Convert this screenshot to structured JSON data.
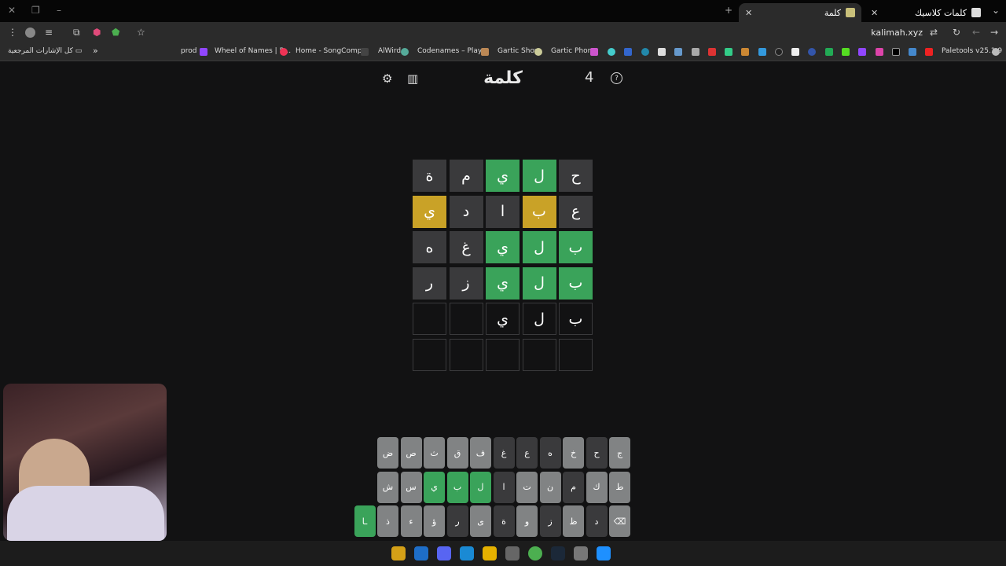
{
  "browser": {
    "tabs": [
      {
        "title": "كلمات كلاسيك"
      },
      {
        "title": "كلمة"
      }
    ],
    "url": "kalimah.xyz",
    "bookmarks_folder": "كل الإشارات المرجعية",
    "bookmarks": [
      "Paletools v25.1.9",
      "Gartic Phone",
      "Gartic Show",
      "Codenames – Play...",
      "AlWird",
      "Home - SongComp...",
      "Wheel of Names | R...",
      "prod"
    ],
    "bookmarks_more": "»"
  },
  "app": {
    "title": "كلمة",
    "count": "4",
    "icons": {
      "stats": "stats-icon",
      "settings": "gear-icon",
      "help": "help-icon"
    }
  },
  "board": {
    "rows": [
      [
        {
          "l": "ح",
          "s": "absent"
        },
        {
          "l": "ل",
          "s": "correct"
        },
        {
          "l": "ي",
          "s": "correct"
        },
        {
          "l": "م",
          "s": "absent"
        },
        {
          "l": "ة",
          "s": "absent"
        }
      ],
      [
        {
          "l": "ع",
          "s": "absent"
        },
        {
          "l": "ب",
          "s": "present"
        },
        {
          "l": "ا",
          "s": "absent"
        },
        {
          "l": "د",
          "s": "absent"
        },
        {
          "l": "ي",
          "s": "present"
        }
      ],
      [
        {
          "l": "ب",
          "s": "correct"
        },
        {
          "l": "ل",
          "s": "correct"
        },
        {
          "l": "ي",
          "s": "correct"
        },
        {
          "l": "غ",
          "s": "absent"
        },
        {
          "l": "ه",
          "s": "absent"
        }
      ],
      [
        {
          "l": "ب",
          "s": "correct"
        },
        {
          "l": "ل",
          "s": "correct"
        },
        {
          "l": "ي",
          "s": "correct"
        },
        {
          "l": "ز",
          "s": "absent"
        },
        {
          "l": "ر",
          "s": "absent"
        }
      ],
      [
        {
          "l": "ب",
          "s": "empty"
        },
        {
          "l": "ل",
          "s": "empty"
        },
        {
          "l": "ي",
          "s": "empty"
        },
        {
          "l": "",
          "s": "empty"
        },
        {
          "l": "",
          "s": "empty"
        }
      ],
      [
        {
          "l": "",
          "s": "empty"
        },
        {
          "l": "",
          "s": "empty"
        },
        {
          "l": "",
          "s": "empty"
        },
        {
          "l": "",
          "s": "empty"
        },
        {
          "l": "",
          "s": "empty"
        }
      ]
    ]
  },
  "keyboard": {
    "rows": [
      [
        {
          "k": "ج",
          "s": "unused"
        },
        {
          "k": "ح",
          "s": "absent"
        },
        {
          "k": "خ",
          "s": "unused"
        },
        {
          "k": "ه",
          "s": "absent"
        },
        {
          "k": "ع",
          "s": "absent"
        },
        {
          "k": "غ",
          "s": "absent"
        },
        {
          "k": "ف",
          "s": "unused"
        },
        {
          "k": "ق",
          "s": "unused"
        },
        {
          "k": "ث",
          "s": "unused"
        },
        {
          "k": "ص",
          "s": "unused"
        },
        {
          "k": "ض",
          "s": "unused"
        }
      ],
      [
        {
          "k": "ط",
          "s": "unused"
        },
        {
          "k": "ك",
          "s": "unused"
        },
        {
          "k": "م",
          "s": "absent"
        },
        {
          "k": "ن",
          "s": "unused"
        },
        {
          "k": "ت",
          "s": "unused"
        },
        {
          "k": "ا",
          "s": "absent"
        },
        {
          "k": "ل",
          "s": "correct"
        },
        {
          "k": "ب",
          "s": "correct"
        },
        {
          "k": "ي",
          "s": "correct"
        },
        {
          "k": "س",
          "s": "unused"
        },
        {
          "k": "ش",
          "s": "unused"
        }
      ],
      [
        {
          "k": "⌫",
          "s": "unused"
        },
        {
          "k": "د",
          "s": "absent"
        },
        {
          "k": "ظ",
          "s": "unused"
        },
        {
          "k": "ز",
          "s": "absent"
        },
        {
          "k": "و",
          "s": "unused"
        },
        {
          "k": "ة",
          "s": "absent"
        },
        {
          "k": "ى",
          "s": "unused"
        },
        {
          "k": "ر",
          "s": "absent"
        },
        {
          "k": "ؤ",
          "s": "unused"
        },
        {
          "k": "ء",
          "s": "unused"
        },
        {
          "k": "ذ",
          "s": "unused"
        },
        {
          "k": "ـا",
          "s": "correct"
        }
      ]
    ]
  },
  "taskbar": {
    "apps": [
      "rockstar-icon",
      "battlenet-icon",
      "discord-icon",
      "edge-icon",
      "explorer-icon",
      "obs-icon",
      "chrome-icon",
      "steam-icon",
      "settings-icon",
      "windows-icon"
    ]
  }
}
